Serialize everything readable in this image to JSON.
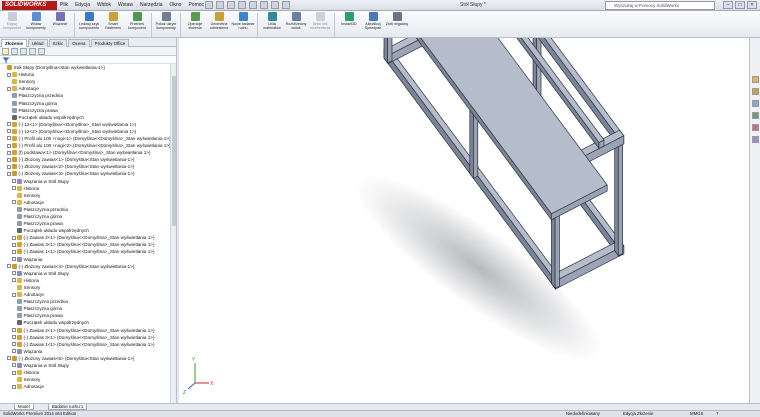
{
  "app": {
    "logo": "SOLIDWORKS",
    "document_title": "Stół Słupy *"
  },
  "menu": [
    "Plik",
    "Edycja",
    "Widok",
    "Wstaw",
    "Narzędzia",
    "Okno",
    "Pomoc"
  ],
  "search": {
    "placeholder": "Wyszukaj w Pomocy SolidWorks"
  },
  "ribbon": [
    {
      "label": "Edytuj komponent",
      "icon": "edit-component-icon",
      "color": "#9aa6b4",
      "enabled": false
    },
    {
      "label": "Wstaw komponenty",
      "icon": "insert-components-icon",
      "color": "#5a8fd0",
      "enabled": true
    },
    {
      "label": "Wiązanie",
      "icon": "mate-icon",
      "color": "#7a6fb0",
      "enabled": true
    },
    {
      "sep": true
    },
    {
      "label": "Liniowy szyk komponentu",
      "icon": "linear-pattern-icon",
      "color": "#3d78c2",
      "enabled": true
    },
    {
      "label": "Smart Fasteners",
      "icon": "smart-fasteners-icon",
      "color": "#c9a13a",
      "enabled": true
    },
    {
      "label": "Przenieś komponent",
      "icon": "move-component-icon",
      "color": "#4f9a4a",
      "enabled": true
    },
    {
      "sep": true
    },
    {
      "label": "Pokaż ukryte komponenty",
      "icon": "show-hidden-icon",
      "color": "#6e7f94",
      "enabled": true
    },
    {
      "sep": true
    },
    {
      "label": "Operacje złożenia",
      "icon": "assembly-features-icon",
      "color": "#5d9a4f",
      "enabled": true
    },
    {
      "label": "Geometria odniesienia",
      "icon": "reference-geometry-icon",
      "color": "#c6a13d",
      "enabled": true
    },
    {
      "label": "Nowe badanie ruchu",
      "icon": "motion-study-icon",
      "color": "#3f83c8",
      "enabled": true
    },
    {
      "sep": true
    },
    {
      "label": "Lista materiałów",
      "icon": "bom-icon",
      "color": "#2f8b9a",
      "enabled": true
    },
    {
      "label": "Rozstrzelony widok",
      "icon": "exploded-view-icon",
      "color": "#6c7fa0",
      "enabled": true
    },
    {
      "label": "Szkic linii rozstrzelenia",
      "icon": "explode-sketch-icon",
      "color": "#a7aeb8",
      "enabled": false
    },
    {
      "sep": true
    },
    {
      "label": "Instant3D",
      "icon": "instant3d-icon",
      "color": "#2f9b6b",
      "enabled": true
    },
    {
      "label": "Aktualizuj Speedpak",
      "icon": "speedpak-icon",
      "color": "#4a79b4",
      "enabled": true
    },
    {
      "label": "Zrób migawkę",
      "icon": "snapshot-icon",
      "color": "#6a7686",
      "enabled": true
    }
  ],
  "command_tabs": [
    "Złożenie",
    "Układ",
    "Szkic",
    "Ocena",
    "Produkty Office"
  ],
  "tree": [
    {
      "level": 0,
      "label": "Stół Słupy  (Domyślna<Stan wyświetlania-1>)",
      "icon": "assembly-icon",
      "color": "#c89b2f"
    },
    {
      "level": 1,
      "label": "Historia",
      "icon": "history-folder-icon",
      "color": "#d9b54a",
      "exp": true
    },
    {
      "level": 1,
      "label": "Sensory",
      "icon": "sensors-folder-icon",
      "color": "#d9b54a"
    },
    {
      "level": 1,
      "label": "Adnotacje",
      "icon": "annotations-folder-icon",
      "color": "#d9b54a",
      "exp": true
    },
    {
      "level": 1,
      "label": "Płaszczyzna przednia",
      "icon": "plane-icon",
      "color": "#8e9db0"
    },
    {
      "level": 1,
      "label": "Płaszczyzna górna",
      "icon": "plane-icon",
      "color": "#8e9db0"
    },
    {
      "level": 1,
      "label": "Płaszczyzna prawa",
      "icon": "plane-icon",
      "color": "#8e9db0"
    },
    {
      "level": 1,
      "label": "Początek układu współrzędnych",
      "icon": "origin-icon",
      "color": "#666666"
    },
    {
      "level": 1,
      "label": "(-) 12<1> (Domyślna<<Domyślna>_Stan wyświetlania 1>)",
      "icon": "part-icon",
      "color": "#d1a33a",
      "exp": true
    },
    {
      "level": 1,
      "label": "(-) 12<2> (Domyślna<<Domyślna>_Stan wyświetlania 1>)",
      "icon": "part-icon",
      "color": "#d1a33a",
      "exp": true
    },
    {
      "level": 1,
      "label": "(-) Profil alu 100 +nogi<1> (Domyślna<<Domyślna>_Stan wyświetlania 1>)",
      "icon": "part-icon",
      "color": "#d1a33a",
      "exp": true
    },
    {
      "level": 1,
      "label": "(-) Profil alu 100 +nogi<2> (Domyślna<<Domyślna>_Stan wyświetlania 1>)",
      "icon": "part-icon",
      "color": "#d1a33a",
      "exp": true
    },
    {
      "level": 1,
      "label": "(f) podstawa<1> (Domyślna<<Domyślna>_Stan wyświetlania 1>)",
      "icon": "part-icon",
      "color": "#d1a33a",
      "exp": true
    },
    {
      "level": 1,
      "label": "(-) Złożony zawias<1> (Domyślna<Stan wyświetlania-1>)",
      "icon": "subassembly-icon",
      "color": "#c89b2f",
      "exp": true
    },
    {
      "level": 1,
      "label": "(-) Złożony zawias<2> (Domyślna<Stan wyświetlania-1>)",
      "icon": "subassembly-icon",
      "color": "#c89b2f",
      "exp": true
    },
    {
      "level": 1,
      "label": "(-) Złożony zawias<3> (Domyślna<Stan wyświetlania-1>)",
      "icon": "subassembly-icon",
      "color": "#c89b2f",
      "exp": true
    },
    {
      "level": 2,
      "label": "Wiązania w Stół Słupy",
      "icon": "mates-folder-icon",
      "color": "#8c8fb5",
      "exp": true
    },
    {
      "level": 2,
      "label": "Historia",
      "icon": "history-folder-icon",
      "color": "#d9b54a",
      "exp": true
    },
    {
      "level": 2,
      "label": "Sensory",
      "icon": "sensors-folder-icon",
      "color": "#d9b54a"
    },
    {
      "level": 2,
      "label": "Adnotacje",
      "icon": "annotations-folder-icon",
      "color": "#d9b54a",
      "exp": true
    },
    {
      "level": 2,
      "label": "Płaszczyzna przednia",
      "icon": "plane-icon",
      "color": "#8e9db0"
    },
    {
      "level": 2,
      "label": "Płaszczyzna górna",
      "icon": "plane-icon",
      "color": "#8e9db0"
    },
    {
      "level": 2,
      "label": "Płaszczyzna prawa",
      "icon": "plane-icon",
      "color": "#8e9db0"
    },
    {
      "level": 2,
      "label": "Początek układu współrzędnych",
      "icon": "origin-icon",
      "color": "#666666"
    },
    {
      "level": 2,
      "label": "(-) Zawias 2<1> (Domyślna<<Domyślna>_Stan wyświetlania 1>)",
      "icon": "part-icon",
      "color": "#d1a33a",
      "exp": true
    },
    {
      "level": 2,
      "label": "(-) Zawias 3<1> (Domyślna<<Domyślna>_Stan wyświetlania 1>)",
      "icon": "part-icon",
      "color": "#d1a33a",
      "exp": true
    },
    {
      "level": 2,
      "label": "(-) Zawias 1<1> (Domyślna<<Domyślna>_Stan wyświetlania 1>)",
      "icon": "part-icon",
      "color": "#d1a33a",
      "exp": true
    },
    {
      "level": 2,
      "label": "Wiązania",
      "icon": "mates-folder-icon",
      "color": "#8c8fb5",
      "exp": true
    },
    {
      "level": 1,
      "label": "(-) Złożony zawias<4> (Domyślna<Stan wyświetlania-1>)",
      "icon": "subassembly-icon",
      "color": "#c89b2f",
      "exp": true
    },
    {
      "level": 2,
      "label": "Wiązania w Stół Słupy",
      "icon": "mates-folder-icon",
      "color": "#8c8fb5",
      "exp": true
    },
    {
      "level": 2,
      "label": "Historia",
      "icon": "history-folder-icon",
      "color": "#d9b54a",
      "exp": true
    },
    {
      "level": 2,
      "label": "Sensory",
      "icon": "sensors-folder-icon",
      "color": "#d9b54a"
    },
    {
      "level": 2,
      "label": "Adnotacje",
      "icon": "annotations-folder-icon",
      "color": "#d9b54a",
      "exp": true
    },
    {
      "level": 2,
      "label": "Płaszczyzna przednia",
      "icon": "plane-icon",
      "color": "#8e9db0"
    },
    {
      "level": 2,
      "label": "Płaszczyzna górna",
      "icon": "plane-icon",
      "color": "#8e9db0"
    },
    {
      "level": 2,
      "label": "Płaszczyzna prawa",
      "icon": "plane-icon",
      "color": "#8e9db0"
    },
    {
      "level": 2,
      "label": "Początek układu współrzędnych",
      "icon": "origin-icon",
      "color": "#666666"
    },
    {
      "level": 2,
      "label": "(-) Zawias 2<1> (Domyślna<<Domyślna>_Stan wyświetlania 1>)",
      "icon": "part-icon",
      "color": "#d1a33a",
      "exp": true
    },
    {
      "level": 2,
      "label": "(-) Zawias 3<1> (Domyślna<<Domyślna>_Stan wyświetlania 1>)",
      "icon": "part-icon",
      "color": "#d1a33a",
      "exp": true
    },
    {
      "level": 2,
      "label": "(-) Zawias 1<1> (Domyślna<<Domyślna>_Stan wyświetlania 1>)",
      "icon": "part-icon",
      "color": "#d1a33a",
      "exp": true
    },
    {
      "level": 2,
      "label": "Wiązania",
      "icon": "mates-folder-icon",
      "color": "#8c8fb5",
      "exp": true
    },
    {
      "level": 1,
      "label": "(-) Złożony zawias<5> (Domyślna<Stan wyświetlania-1>)",
      "icon": "subassembly-icon",
      "color": "#c89b2f",
      "exp": true
    },
    {
      "level": 2,
      "label": "Wiązania w Stół Słupy",
      "icon": "mates-folder-icon",
      "color": "#8c8fb5",
      "exp": true
    },
    {
      "level": 2,
      "label": "Historia",
      "icon": "history-folder-icon",
      "color": "#d9b54a",
      "exp": true
    },
    {
      "level": 2,
      "label": "Sensory",
      "icon": "sensors-folder-icon",
      "color": "#d9b54a"
    },
    {
      "level": 2,
      "label": "Adnotacje",
      "icon": "annotations-folder-icon",
      "color": "#d9b54a",
      "exp": true
    }
  ],
  "bottom_tabs": [
    "Model",
    "Badanie ruchu 1"
  ],
  "status": {
    "product": "SolidWorks Premium 2014 x64 Edition",
    "definition": "Niedodefiniowany",
    "mode": "Edycja Złożenie",
    "units": "MMGS"
  },
  "colors": {
    "accent": "#b01a1a",
    "model_steel": "#8a93a6"
  }
}
